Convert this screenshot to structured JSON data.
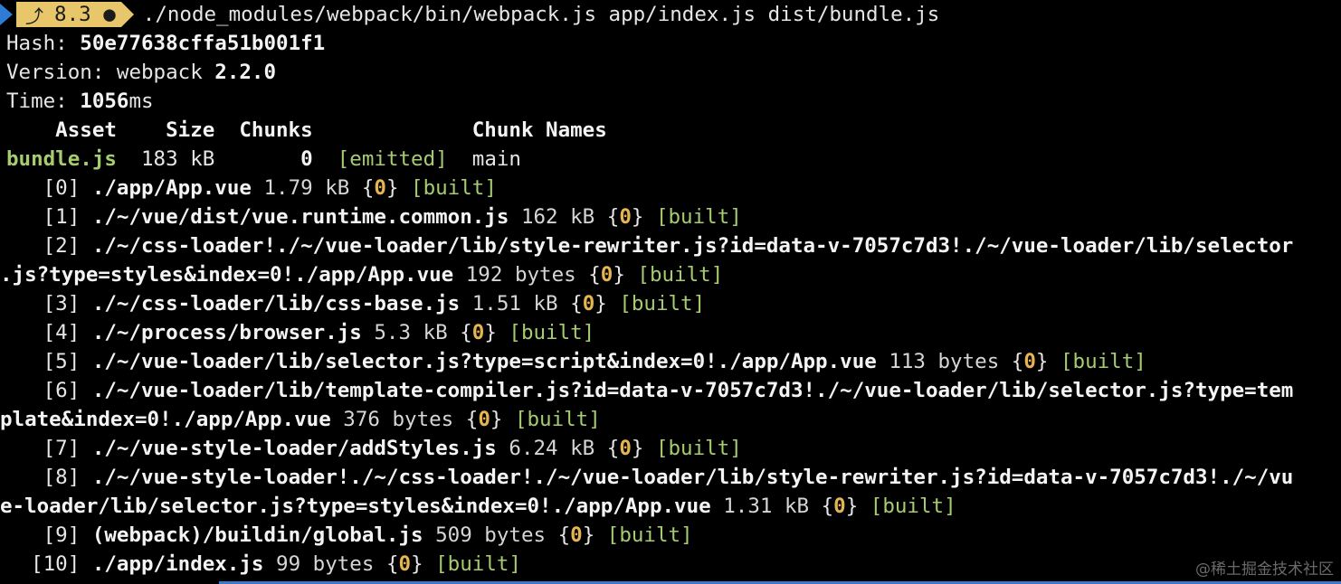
{
  "prompt": {
    "node_version": "8.3",
    "git_dirty_indicator": "●",
    "command": "./node_modules/webpack/bin/webpack.js app/index.js dist/bundle.js"
  },
  "summary": {
    "hash_label": "Hash: ",
    "hash_value": "50e77638cffa51b001f1",
    "version_label": "Version: webpack ",
    "version_value": "2.2.0",
    "time_label": "Time: ",
    "time_value": "1056",
    "time_unit": "ms"
  },
  "asset_table": {
    "header": "    Asset    Size  Chunks             Chunk Names",
    "row": {
      "asset": "bundle.js",
      "size": "  183 kB       ",
      "chunk": "0",
      "status": "  [emitted]",
      "chunk_name": "  main"
    }
  },
  "modules": [
    {
      "index": "   [0] ",
      "path": "./app/App.vue",
      "size": " 1.79 kB ",
      "chunk": "0",
      "status": "[built]"
    },
    {
      "index": "   [1] ",
      "path": "./~/vue/dist/vue.runtime.common.js",
      "size": " 162 kB ",
      "chunk": "0",
      "status": "[built]"
    },
    {
      "index": "   [2] ",
      "path": "./~/css-loader!./~/vue-loader/lib/style-rewriter.js?id=data-v-7057c7d3!./~/vue-loader/lib/selector",
      "path_cont": ".js?type=styles&index=0!./app/App.vue",
      "size": " 192 bytes ",
      "chunk": "0",
      "status": "[built]"
    },
    {
      "index": "   [3] ",
      "path": "./~/css-loader/lib/css-base.js",
      "size": " 1.51 kB ",
      "chunk": "0",
      "status": "[built]"
    },
    {
      "index": "   [4] ",
      "path": "./~/process/browser.js",
      "size": " 5.3 kB ",
      "chunk": "0",
      "status": "[built]"
    },
    {
      "index": "   [5] ",
      "path": "./~/vue-loader/lib/selector.js?type=script&index=0!./app/App.vue",
      "size": " 113 bytes ",
      "chunk": "0",
      "status": "[built]"
    },
    {
      "index": "   [6] ",
      "path": "./~/vue-loader/lib/template-compiler.js?id=data-v-7057c7d3!./~/vue-loader/lib/selector.js?type=tem",
      "path_cont": "plate&index=0!./app/App.vue",
      "size": " 376 bytes ",
      "chunk": "0",
      "status": "[built]"
    },
    {
      "index": "   [7] ",
      "path": "./~/vue-style-loader/addStyles.js",
      "size": " 6.24 kB ",
      "chunk": "0",
      "status": "[built]"
    },
    {
      "index": "   [8] ",
      "path": "./~/vue-style-loader!./~/css-loader!./~/vue-loader/lib/style-rewriter.js?id=data-v-7057c7d3!./~/vu",
      "path_cont": "e-loader/lib/selector.js?type=styles&index=0!./app/App.vue",
      "size": " 1.31 kB ",
      "chunk": "0",
      "status": "[built]"
    },
    {
      "index": "   [9] ",
      "path": "(webpack)/buildin/global.js",
      "size": " 509 bytes ",
      "chunk": "0",
      "status": "[built]"
    },
    {
      "index": "  [10] ",
      "path": "./app/index.js",
      "size": " 99 bytes ",
      "chunk": "0",
      "status": "[built]"
    }
  ],
  "watermark": "@稀土掘金技术社区",
  "colors": {
    "background": "#000000",
    "green": "#a6cc70",
    "yellow": "#e6b450",
    "prompt_blue": "#2f7bd6",
    "prompt_yellow": "#e8c66a"
  }
}
